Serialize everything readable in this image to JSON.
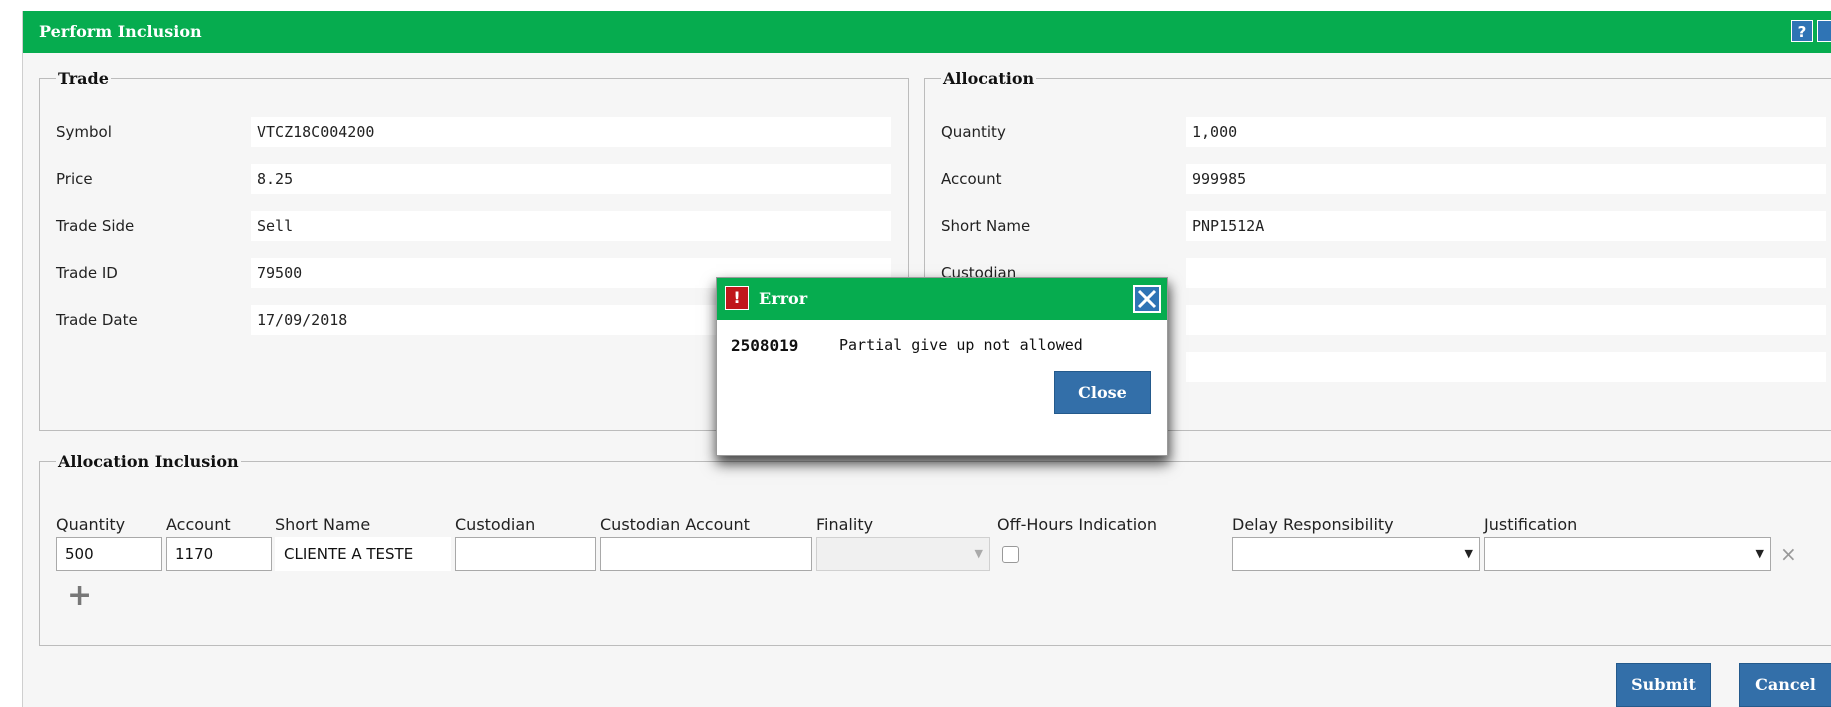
{
  "window": {
    "title": "Perform Inclusion",
    "help_label": "?"
  },
  "trade": {
    "legend": "Trade",
    "fields": [
      {
        "label": "Symbol",
        "value": "VTCZ18C004200"
      },
      {
        "label": "Price",
        "value": "8.25"
      },
      {
        "label": "Trade Side",
        "value": "Sell"
      },
      {
        "label": "Trade ID",
        "value": "79500"
      },
      {
        "label": "Trade Date",
        "value": "17/09/2018"
      }
    ]
  },
  "allocation": {
    "legend": "Allocation",
    "fields": [
      {
        "label": "Quantity",
        "value": "1,000"
      },
      {
        "label": "Account",
        "value": "999985"
      },
      {
        "label": "Short Name",
        "value": "PNP1512A"
      },
      {
        "label": "Custodian",
        "value": ""
      }
    ]
  },
  "inclusion": {
    "legend": "Allocation Inclusion",
    "headers": {
      "quantity": "Quantity",
      "account": "Account",
      "short_name": "Short Name",
      "custodian": "Custodian",
      "custodian_account": "Custodian Account",
      "finality": "Finality",
      "off_hours": "Off-Hours Indication",
      "delay": "Delay Responsibility",
      "justification": "Justification"
    },
    "row": {
      "quantity": "500",
      "account": "1170",
      "short_name": "CLIENTE A TESTE",
      "custodian": "",
      "custodian_account": "",
      "finality": "",
      "off_hours_checked": false,
      "delay": "",
      "justification": ""
    },
    "add_label": "+",
    "remove_label": "×"
  },
  "buttons": {
    "submit": "Submit",
    "cancel": "Cancel"
  },
  "error_dialog": {
    "title": "Error",
    "icon_label": "!",
    "code": "2508019",
    "message": "Partial give up not allowed",
    "close_label": "Close"
  },
  "colors": {
    "title_bar": "#06ac4f",
    "button": "#336fa9",
    "error_icon": "#c0161b"
  },
  "icons": {
    "help": "help-icon",
    "error": "error-icon",
    "dialog_close": "close-icon",
    "add": "plus-icon",
    "remove": "remove-icon"
  }
}
